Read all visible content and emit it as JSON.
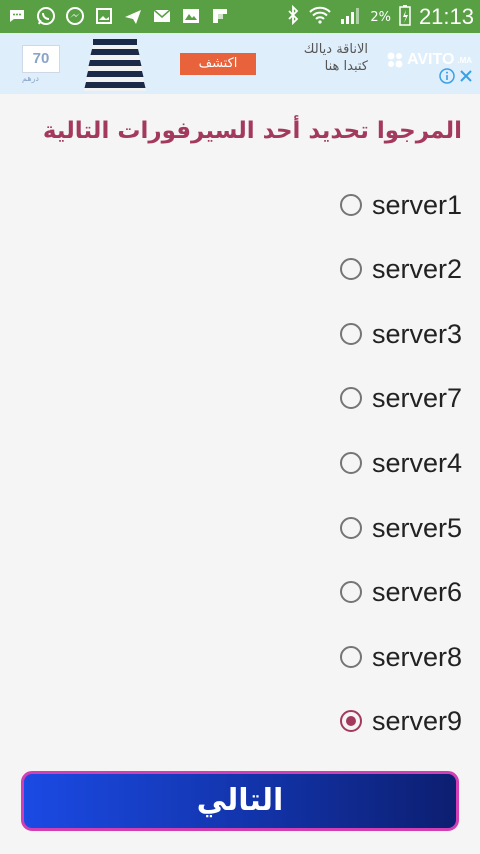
{
  "status_bar": {
    "battery_percent": "2%",
    "time": "21:13",
    "icons": [
      "message-icon",
      "whatsapp-icon",
      "messenger-icon",
      "image-icon",
      "airplane-icon",
      "mail-icon",
      "gallery-icon",
      "flipboard-icon",
      "bluetooth-icon",
      "wifi-icon",
      "signal-icon",
      "battery-icon"
    ]
  },
  "ad": {
    "price": "70",
    "currency": "درهم",
    "cta": "اكتشف",
    "text_line1": "الاناقة ديالك",
    "text_line2": "كتبدا هنا",
    "brand": "AVITO",
    "brand_suffix": ".MA"
  },
  "title": "المرجوا تحديد أحد السيرفورات التالية",
  "servers": [
    {
      "label": "server1",
      "checked": false
    },
    {
      "label": "server2",
      "checked": false
    },
    {
      "label": "server3",
      "checked": false
    },
    {
      "label": "server7",
      "checked": false
    },
    {
      "label": "server4",
      "checked": false
    },
    {
      "label": "server5",
      "checked": false
    },
    {
      "label": "server6",
      "checked": false
    },
    {
      "label": "server8",
      "checked": false
    },
    {
      "label": "server9",
      "checked": true
    }
  ],
  "next_button": "التالي",
  "colors": {
    "status_bar": "#58a043",
    "accent": "#a33a5d",
    "button_border": "#d23fb5",
    "button_bg": "#1233a8"
  }
}
